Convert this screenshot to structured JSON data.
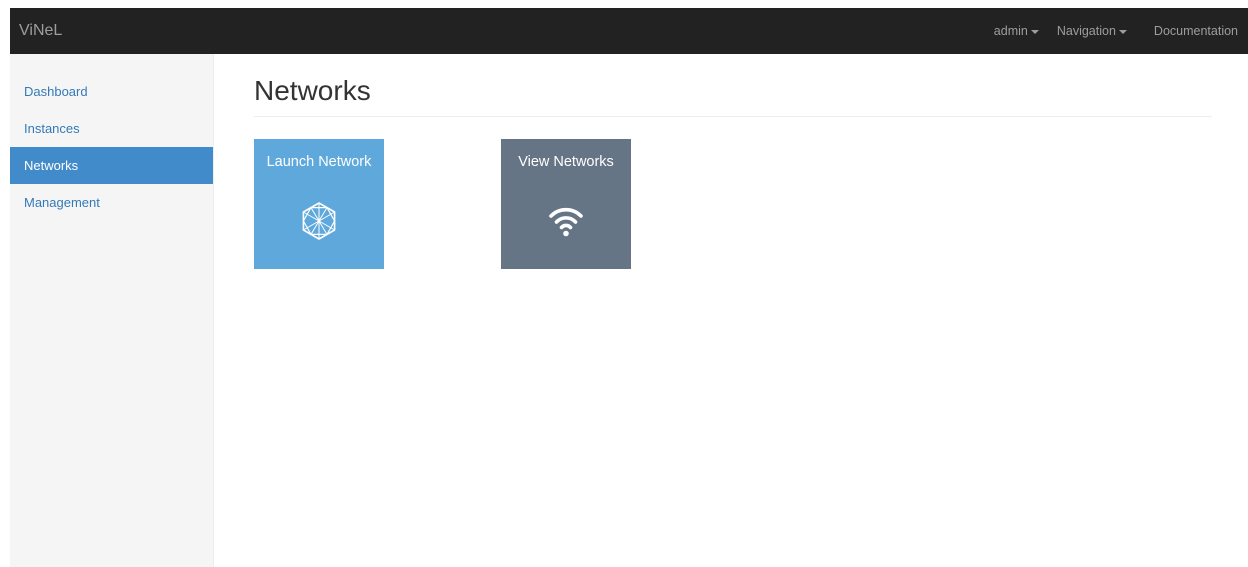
{
  "navbar": {
    "brand": "ViNeL",
    "items": [
      {
        "label": "admin",
        "dropdown": true
      },
      {
        "label": "Navigation",
        "dropdown": true
      },
      {
        "label": "Documentation",
        "dropdown": false
      }
    ]
  },
  "sidebar": {
    "items": [
      {
        "label": "Dashboard",
        "active": false
      },
      {
        "label": "Instances",
        "active": false
      },
      {
        "label": "Networks",
        "active": true
      },
      {
        "label": "Management",
        "active": false
      }
    ]
  },
  "main": {
    "title": "Networks",
    "tiles": [
      {
        "label": "Launch Network",
        "icon": "network-mesh-icon",
        "color": "#5fa8dc"
      },
      {
        "label": "View Networks",
        "icon": "wifi-icon",
        "color": "#667586"
      }
    ]
  },
  "colors": {
    "navbar_bg": "#222222",
    "sidebar_bg": "#f5f5f5",
    "active_bg": "#428bca",
    "link": "#337ab7"
  }
}
